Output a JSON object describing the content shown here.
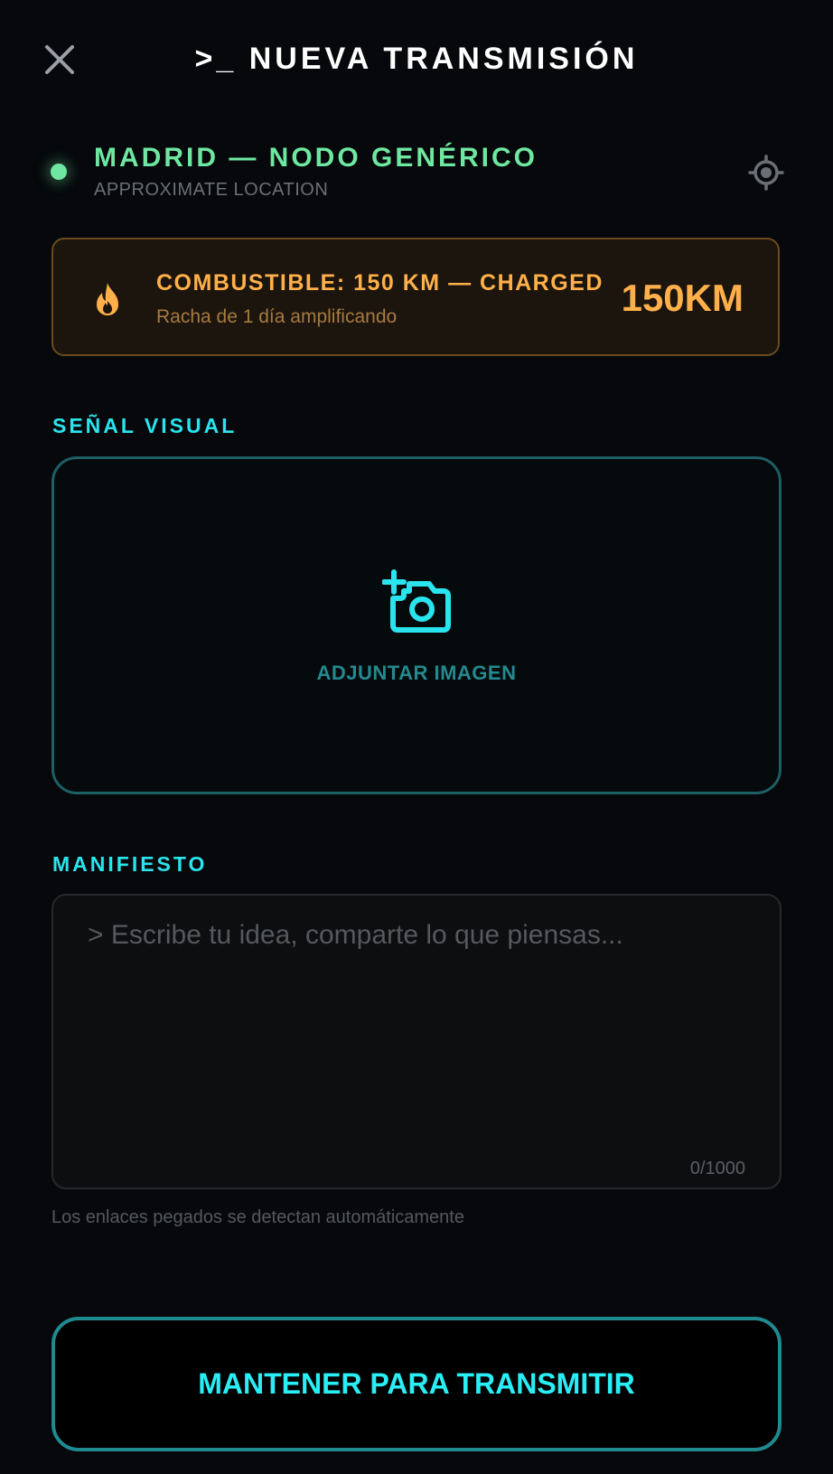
{
  "header": {
    "title": ">_ NUEVA TRANSMISIÓN"
  },
  "location": {
    "name": "MADRID — NODO GENÉRICO",
    "subtitle": "APPROXIMATE LOCATION",
    "status_color": "#6ee7a0"
  },
  "fuel": {
    "title": "COMBUSTIBLE: 150 KM — CHARGED",
    "subtitle": "Racha de 1 día amplificando",
    "value": "150KM",
    "accent_color": "#ffb04a",
    "icon": "flame-icon"
  },
  "visual_signal": {
    "label": "SEÑAL VISUAL",
    "dropzone_label": "ADJUNTAR IMAGEN",
    "icon": "add-photo-icon"
  },
  "manifest": {
    "label": "MANIFIESTO",
    "value": "",
    "placeholder": "> Escribe tu idea, comparte lo que piensas...",
    "char_count": "0/1000",
    "hint": "Los enlaces pegados se detectan automáticamente"
  },
  "action": {
    "transmit_label": "MANTENER PARA TRANSMITIR",
    "accent_color": "#29eef5"
  }
}
